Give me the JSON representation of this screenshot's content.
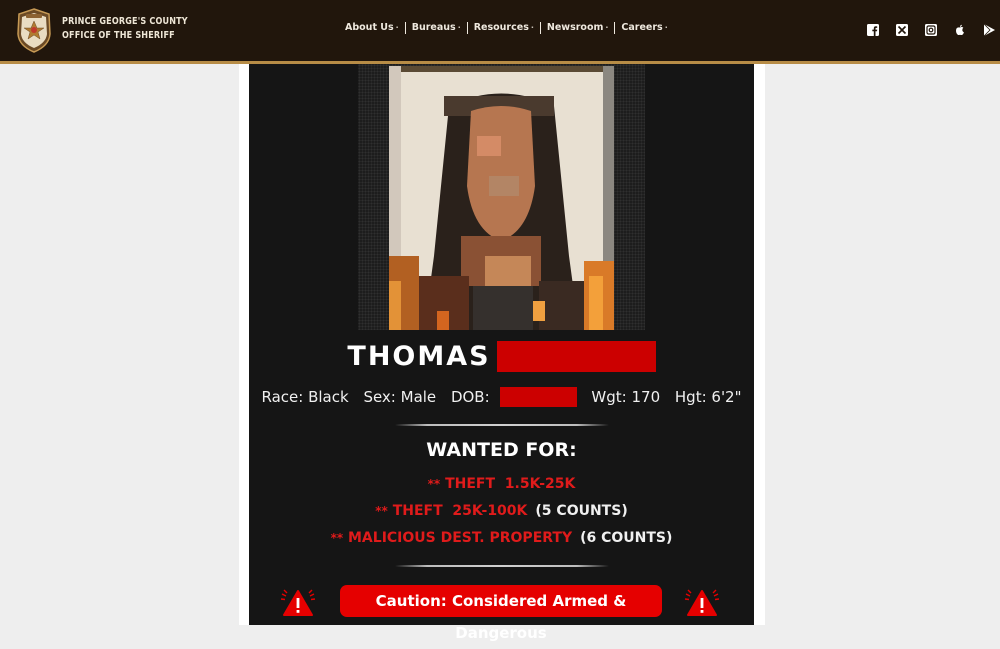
{
  "header": {
    "brand_line1": "PRINCE GEORGE'S COUNTY",
    "brand_line2": "OFFICE OF THE SHERIFF",
    "nav": [
      {
        "label": "About Us",
        "has_dropdown": true
      },
      {
        "label": "Bureaus",
        "has_dropdown": true
      },
      {
        "label": "Resources",
        "has_dropdown": true
      },
      {
        "label": "Newsroom",
        "has_dropdown": true
      },
      {
        "label": "Careers",
        "has_dropdown": true
      }
    ],
    "dropdown_marker": "·",
    "social": [
      "facebook-icon",
      "x-twitter-icon",
      "instagram-icon",
      "apple-app-store-icon",
      "google-play-icon"
    ]
  },
  "poster": {
    "first_name": "THOMAS",
    "last_name_redacted": true,
    "details": {
      "race": "Race: Black",
      "sex": "Sex: Male",
      "dob_label": "DOB:",
      "dob_redacted": true,
      "weight": "Wgt: 170",
      "height": "Hgt: 6'2\""
    },
    "wanted_title": "WANTED FOR:",
    "charges": [
      {
        "prefix": "**",
        "text": "THEFT  1.5K-25K",
        "counts": ""
      },
      {
        "prefix": "**",
        "text": "THEFT  25K-100K",
        "counts": "(5 COUNTS)"
      },
      {
        "prefix": "**",
        "text": "MALICIOUS DEST. PROPERTY",
        "counts": "(6 COUNTS)"
      }
    ],
    "caution": "Caution: Considered Armed & Dangerous"
  },
  "colors": {
    "header_bg": "#21160c",
    "header_accent": "#b78c46",
    "poster_bg": "#151515",
    "alert_red": "#e50000",
    "redaction_red": "#cc0000"
  }
}
